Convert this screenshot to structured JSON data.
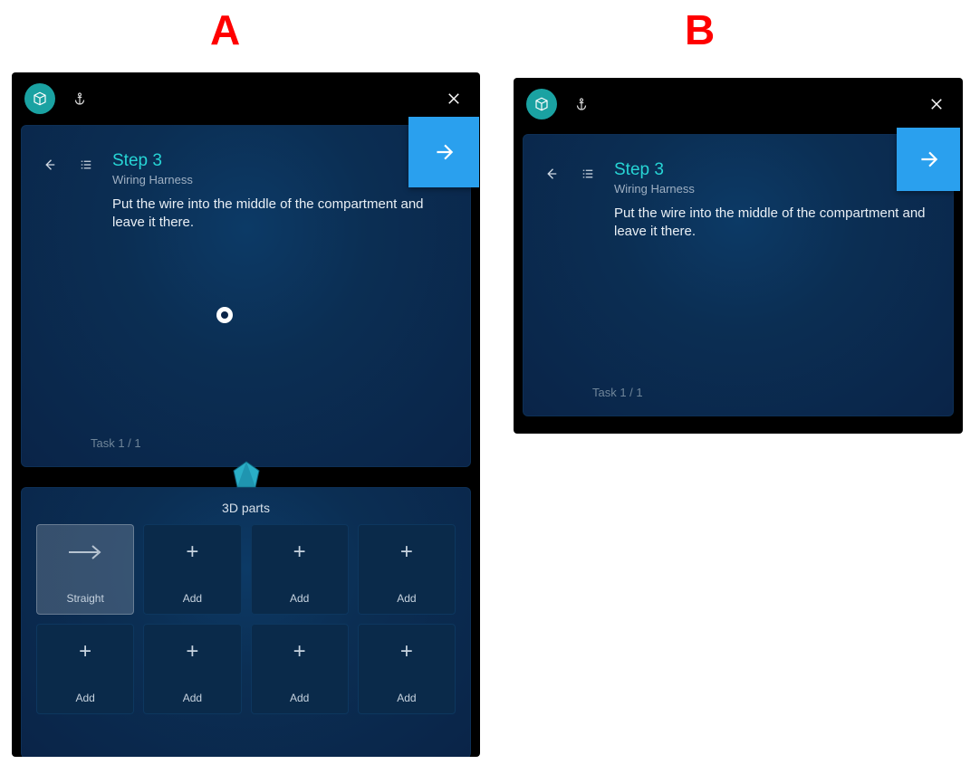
{
  "figureLabels": {
    "A": "A",
    "B": "B"
  },
  "panelA": {
    "step": {
      "title": "Step 3",
      "subtitle": "Wiring Harness",
      "description": "Put the wire into the middle of the compartment and leave it there.",
      "taskCounter": "Task 1 / 1"
    },
    "parts": {
      "title": "3D parts",
      "tiles": [
        {
          "label": "Straight",
          "kind": "arrow"
        },
        {
          "label": "Add",
          "kind": "add"
        },
        {
          "label": "Add",
          "kind": "add"
        },
        {
          "label": "Add",
          "kind": "add"
        },
        {
          "label": "Add",
          "kind": "add"
        },
        {
          "label": "Add",
          "kind": "add"
        },
        {
          "label": "Add",
          "kind": "add"
        },
        {
          "label": "Add",
          "kind": "add"
        }
      ]
    }
  },
  "panelB": {
    "step": {
      "title": "Step 3",
      "subtitle": "Wiring Harness",
      "description": "Put the wire into the middle of the compartment and leave it there.",
      "taskCounter": "Task 1 / 1"
    }
  }
}
